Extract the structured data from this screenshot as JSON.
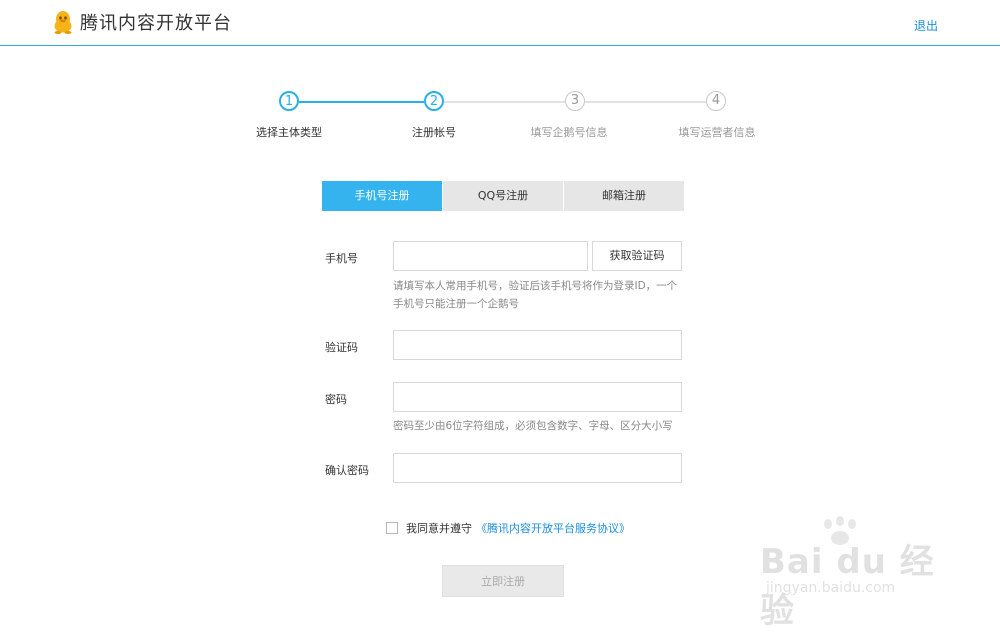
{
  "header": {
    "logo_text": "腾讯内容开放平台",
    "logout_label": "退出"
  },
  "steps": [
    {
      "number": "1",
      "label": "选择主体类型",
      "state": "active"
    },
    {
      "number": "2",
      "label": "注册帐号",
      "state": "active"
    },
    {
      "number": "3",
      "label": "填写企鹅号信息",
      "state": "inactive"
    },
    {
      "number": "4",
      "label": "填写运营者信息",
      "state": "inactive"
    }
  ],
  "tabs": [
    {
      "label": "手机号注册",
      "active": true
    },
    {
      "label": "QQ号注册",
      "active": false
    },
    {
      "label": "邮箱注册",
      "active": false
    }
  ],
  "form": {
    "phone_label": "手机号",
    "phone_value": "",
    "get_code_label": "获取验证码",
    "phone_hint_line1": "请填写本人常用手机号，验证后该手机号将作为登录ID，一个",
    "phone_hint_line2": "手机号只能注册一个企鹅号",
    "code_label": "验证码",
    "code_value": "",
    "password_label": "密码",
    "password_value": "",
    "password_hint": "密码至少由6位字符组成，必须包含数字、字母、区分大小写",
    "confirm_label": "确认密码",
    "confirm_value": ""
  },
  "agreement": {
    "checked": false,
    "text": "我同意并遵守",
    "link": "《腾讯内容开放平台服务协议》"
  },
  "submit_label": "立即注册",
  "watermark": {
    "main": "Bai du 经验",
    "sub": "jingyan.baidu.com"
  },
  "colors": {
    "accent": "#29b0ea",
    "link": "#1b8fd8",
    "tab_active": "#35b3ee",
    "logo_yellow": "#f5b31a"
  },
  "icons": {
    "logo": "penguin-icon",
    "checkbox": "checkbox-icon"
  }
}
